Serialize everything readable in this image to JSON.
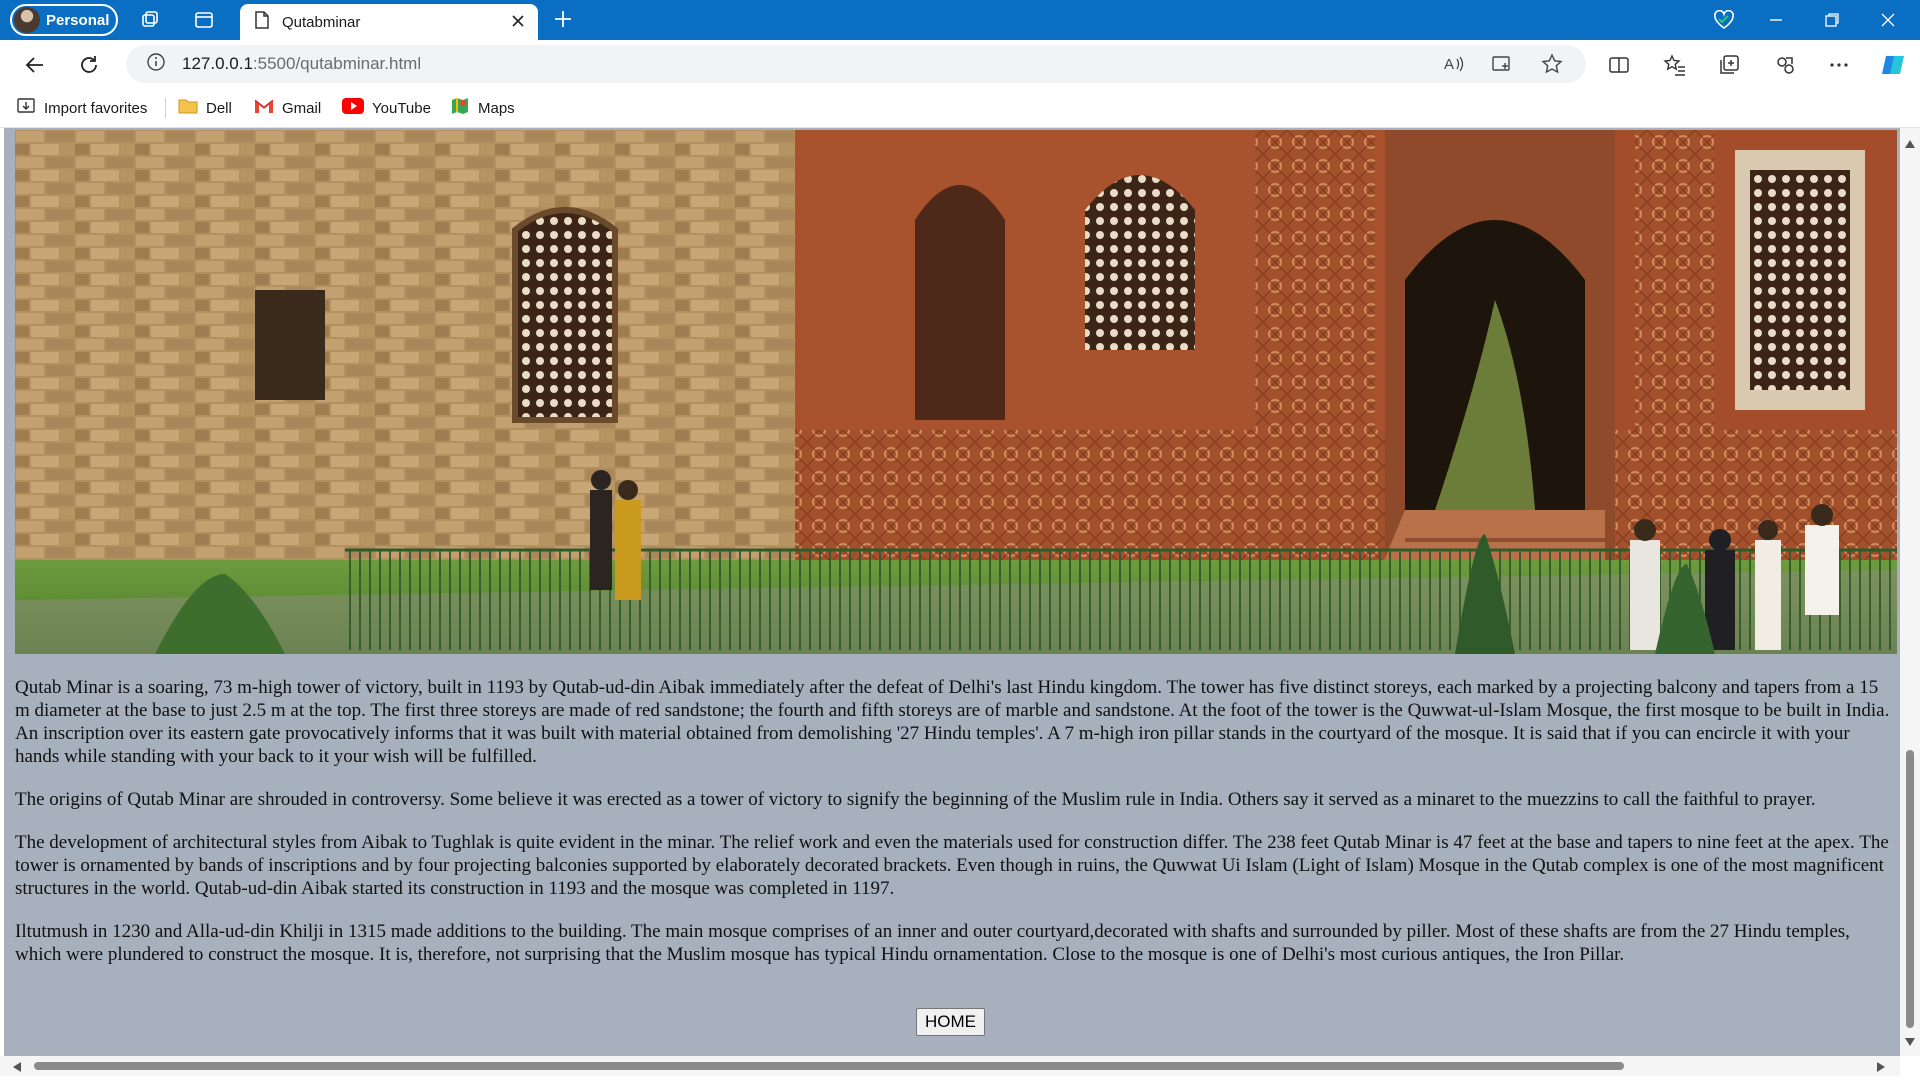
{
  "browser": {
    "profile_label": "Personal",
    "tab_title": "Qutabminar",
    "url_host": "127.0.0.1",
    "url_path": ":5500/qutabminar.html"
  },
  "favorites": [
    {
      "label": "Import favorites",
      "icon": "import-icon"
    },
    {
      "label": "Dell",
      "icon": "folder-icon"
    },
    {
      "label": "Gmail",
      "icon": "gmail-icon"
    },
    {
      "label": "YouTube",
      "icon": "youtube-icon"
    },
    {
      "label": "Maps",
      "icon": "maps-icon"
    }
  ],
  "page": {
    "background_color": "#a7b0bd",
    "hero_image": "qutab-complex-photo",
    "paragraphs": [
      "Qutab Minar is a soaring, 73 m-high tower of victory, built in 1193 by Qutab-ud-din Aibak immediately after the defeat of Delhi's last Hindu kingdom. The tower has five distinct storeys, each marked by a projecting balcony and tapers from a 15 m diameter at the base to just 2.5 m at the top. The first three storeys are made of red sandstone; the fourth and fifth storeys are of marble and sandstone. At the foot of the tower is the Quwwat-ul-Islam Mosque, the first mosque to be built in India. An inscription over its eastern gate provocatively informs that it was built with material obtained from demolishing '27 Hindu temples'. A 7 m-high iron pillar stands in the courtyard of the mosque. It is said that if you can encircle it with your hands while standing with your back to it your wish will be fulfilled.",
      "The origins of Qutab Minar are shrouded in controversy. Some believe it was erected as a tower of victory to signify the beginning of the Muslim rule in India. Others say it served as a minaret to the muezzins to call the faithful to prayer.",
      "The development of architectural styles from Aibak to Tughlak is quite evident in the minar. The relief work and even the materials used for construction differ. The 238 feet Qutab Minar is 47 feet at the base and tapers to nine feet at the apex. The tower is ornamented by bands of inscriptions and by four projecting balconies supported by elaborately decorated brackets. Even though in ruins, the Quwwat Ui Islam (Light of Islam) Mosque in the Qutab complex is one of the most magnificent structures in the world. Qutab-ud-din Aibak started its construction in 1193 and the mosque was completed in 1197.",
      "Iltutmush in 1230 and Alla-ud-din Khilji in 1315 made additions to the building. The main mosque comprises of an inner and outer courtyard,decorated with shafts and surrounded by piller. Most of these shafts are from the 27 Hindu temples, which were plundered to construct the mosque. It is, therefore, not surprising that the Muslim mosque has typical Hindu ornamentation. Close to the mosque is one of Delhi's most curious antiques, the Iron Pillar."
    ],
    "home_button": "HOME"
  }
}
